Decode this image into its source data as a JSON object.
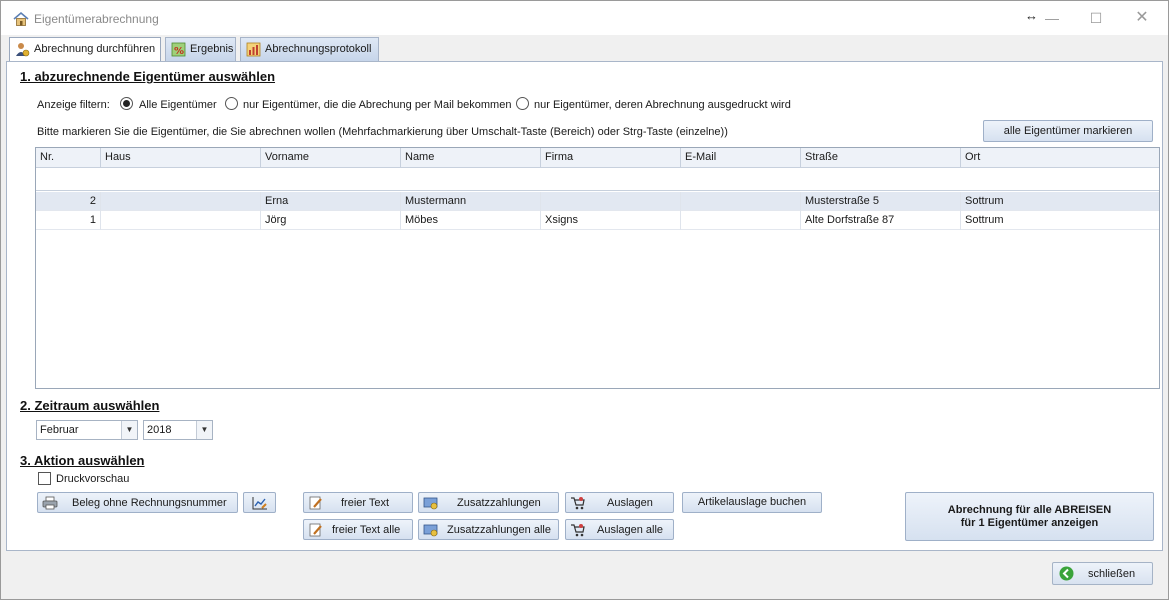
{
  "window": {
    "title": "Eigentümerabrechnung"
  },
  "tabs": [
    {
      "label": "Abrechnung durchführen"
    },
    {
      "label": "Ergebnis"
    },
    {
      "label": "Abrechnungsprotokoll"
    }
  ],
  "section1": {
    "title": "1. abzurechnende Eigentümer auswählen",
    "filter_label": "Anzeige filtern:",
    "radios": [
      {
        "label": "Alle Eigentümer",
        "checked": true
      },
      {
        "label": "nur Eigentümer, die die Abrechung per Mail bekommen",
        "checked": false
      },
      {
        "label": "nur Eigentümer, deren Abrechnung ausgedruckt wird",
        "checked": false
      }
    ],
    "hint": "Bitte markieren Sie die Eigentümer, die Sie abrechnen wollen (Mehrfachmarkierung über Umschalt-Taste (Bereich) oder Strg-Taste (einzelne))",
    "mark_all_button": "alle Eigentümer markieren"
  },
  "grid": {
    "columns": [
      "Nr.",
      "Haus",
      "Vorname",
      "Name",
      "Firma",
      "E-Mail",
      "Straße",
      "Ort"
    ],
    "rows": [
      {
        "nr": "2",
        "haus": "",
        "vorname": "Erna",
        "name": "Mustermann",
        "firma": "",
        "email": "",
        "strasse": "Musterstraße 5",
        "ort": "Sottrum"
      },
      {
        "nr": "1",
        "haus": "",
        "vorname": "Jörg",
        "name": "Möbes",
        "firma": "Xsigns",
        "email": "",
        "strasse": "Alte Dorfstraße 87",
        "ort": "Sottrum"
      }
    ]
  },
  "section2": {
    "title": "2. Zeitraum auswählen",
    "month": "Februar",
    "year": "2018"
  },
  "section3": {
    "title": "3. Aktion auswählen",
    "preview_label": "Druckvorschau",
    "preview_checked": false,
    "buttons": {
      "beleg": "Beleg ohne Rechnungsnummer",
      "freier_text": "freier Text",
      "freier_text_alle": "freier Text alle",
      "zusatz": "Zusatzzahlungen",
      "zusatz_alle": "Zusatzzahlungen alle",
      "auslagen": "Auslagen",
      "auslagen_alle": "Auslagen alle",
      "artikel": "Artikelauslage buchen",
      "main_line1": "Abrechnung für alle ABREISEN",
      "main_line2": "für 1 Eigentümer anzeigen"
    }
  },
  "footer": {
    "close_label": "schließen"
  }
}
